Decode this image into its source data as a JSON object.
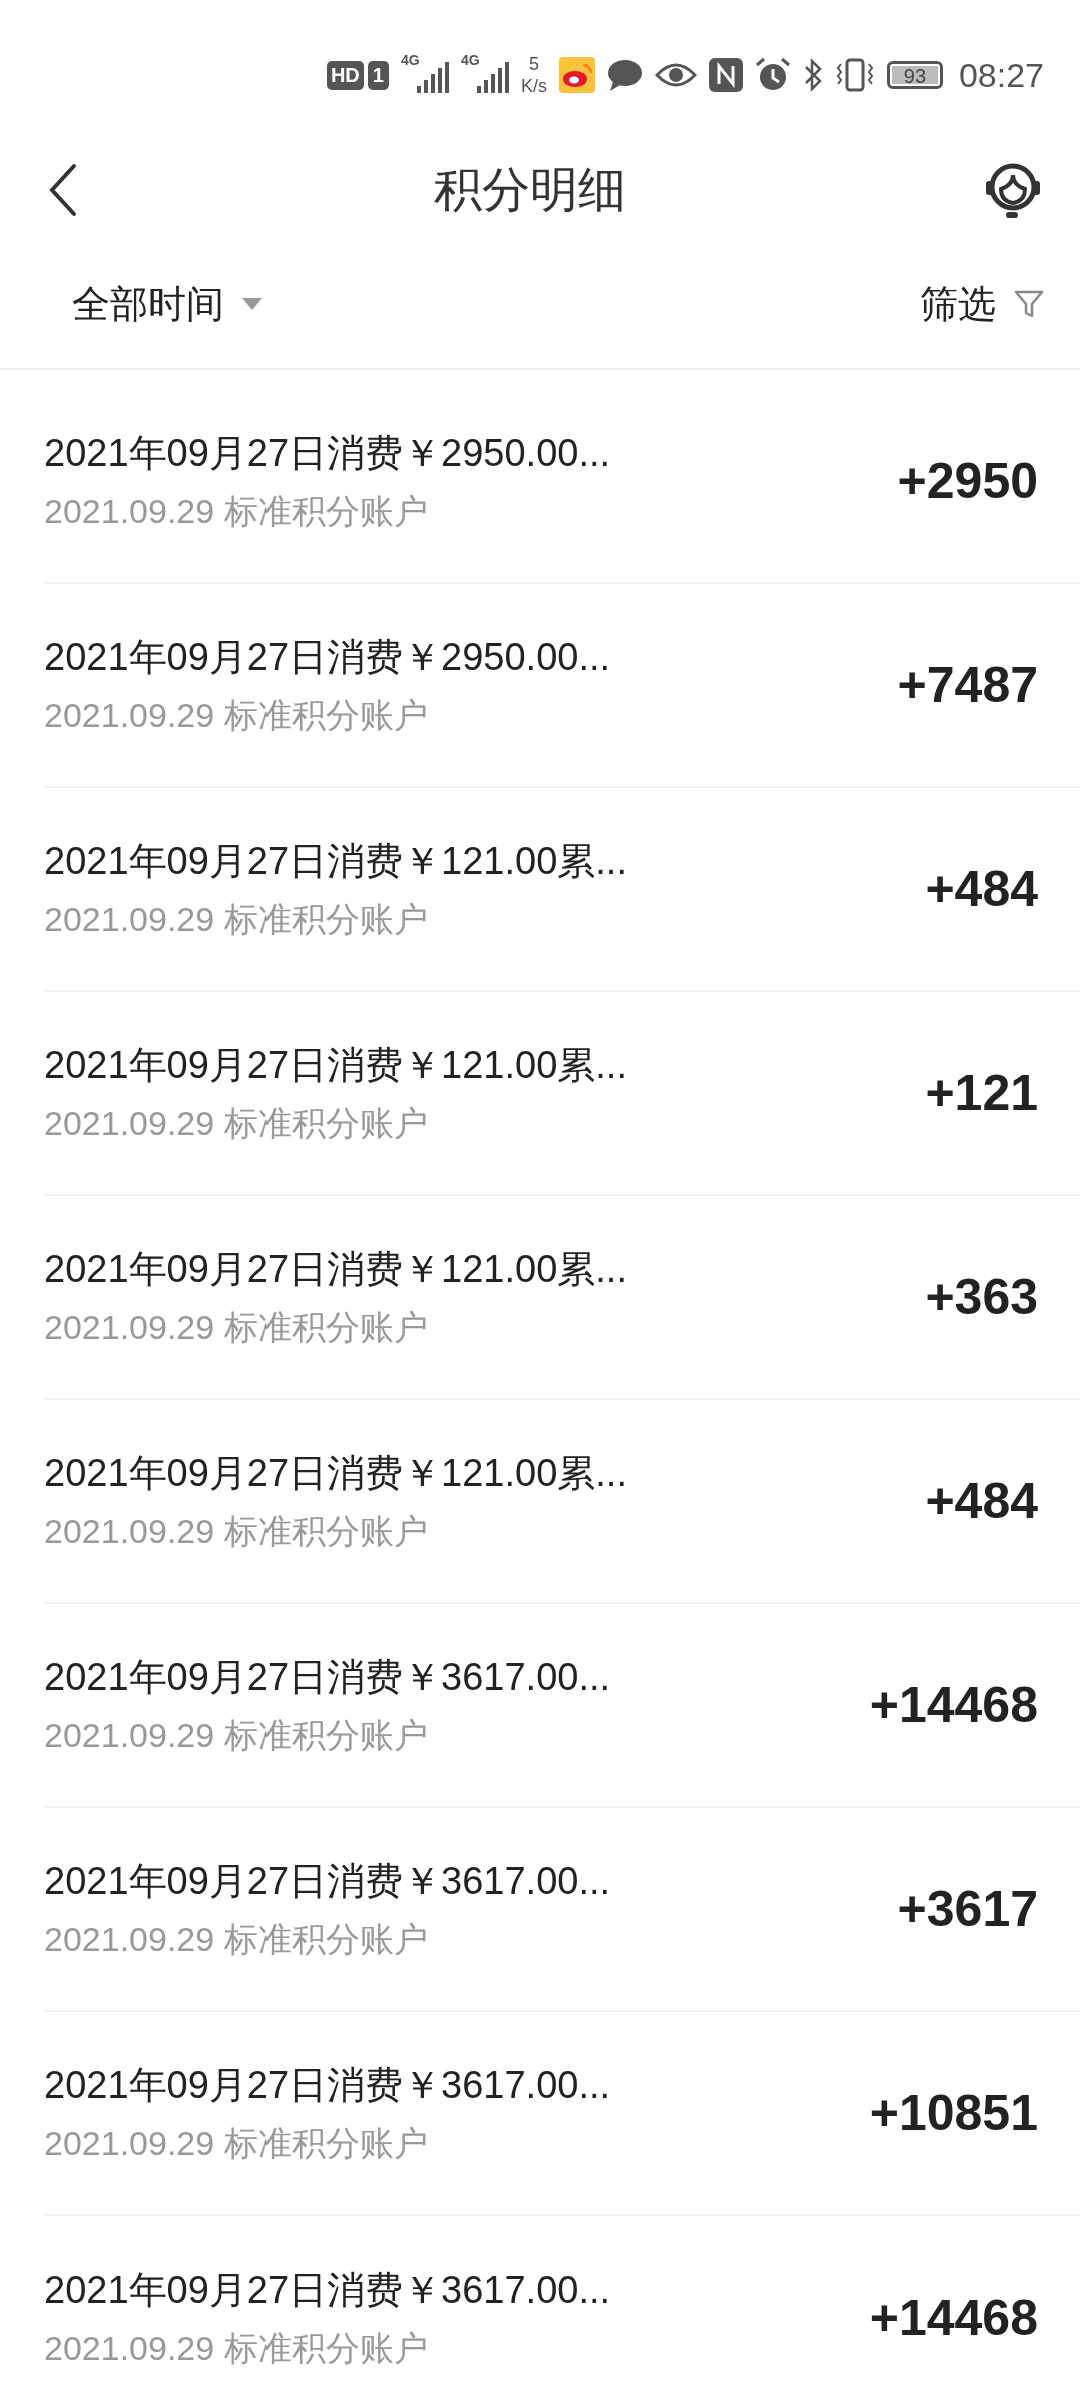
{
  "status_bar": {
    "hd": "HD",
    "sim": "1",
    "signals": [
      "4G",
      "4G"
    ],
    "speed_value": "5",
    "speed_unit": "K/s",
    "battery": "93",
    "time": "08:27"
  },
  "header": {
    "title": "积分明细"
  },
  "filter_bar": {
    "time_range": "全部时间",
    "filter": "筛选"
  },
  "records": [
    {
      "title": "2021年09月27日消费￥2950.00...",
      "subtitle": "2021.09.29 标准积分账户",
      "points": "+2950"
    },
    {
      "title": "2021年09月27日消费￥2950.00...",
      "subtitle": "2021.09.29 标准积分账户",
      "points": "+7487"
    },
    {
      "title": "2021年09月27日消费￥121.00累...",
      "subtitle": "2021.09.29 标准积分账户",
      "points": "+484"
    },
    {
      "title": "2021年09月27日消费￥121.00累...",
      "subtitle": "2021.09.29 标准积分账户",
      "points": "+121"
    },
    {
      "title": "2021年09月27日消费￥121.00累...",
      "subtitle": "2021.09.29 标准积分账户",
      "points": "+363"
    },
    {
      "title": "2021年09月27日消费￥121.00累...",
      "subtitle": "2021.09.29 标准积分账户",
      "points": "+484"
    },
    {
      "title": "2021年09月27日消费￥3617.00...",
      "subtitle": "2021.09.29 标准积分账户",
      "points": "+14468"
    },
    {
      "title": "2021年09月27日消费￥3617.00...",
      "subtitle": "2021.09.29 标准积分账户",
      "points": "+3617"
    },
    {
      "title": "2021年09月27日消费￥3617.00...",
      "subtitle": "2021.09.29 标准积分账户",
      "points": "+10851"
    },
    {
      "title": "2021年09月27日消费￥3617.00...",
      "subtitle": "2021.09.29 标准积分账户",
      "points": "+14468"
    }
  ]
}
